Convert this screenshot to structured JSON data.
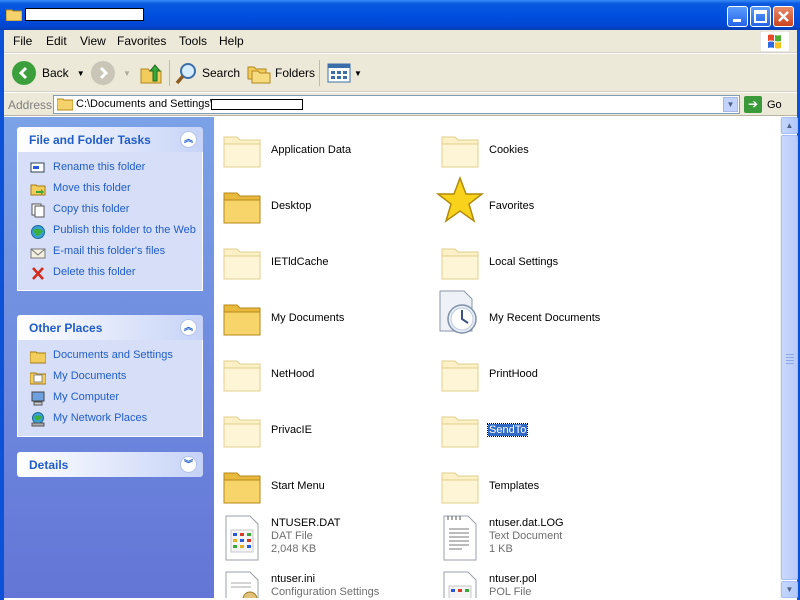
{
  "window": {
    "title": "",
    "controls": [
      "minimize",
      "maximize",
      "close"
    ]
  },
  "menu": [
    "File",
    "Edit",
    "View",
    "Favorites",
    "Tools",
    "Help"
  ],
  "toolbar": {
    "back": "Back",
    "search": "Search",
    "folders": "Folders"
  },
  "address": {
    "label": "Address",
    "path": "C:\\Documents and Settings\\",
    "go": "Go"
  },
  "tasks_panel": {
    "title": "File and Folder Tasks",
    "items": [
      {
        "label": "Rename this folder",
        "icon": "rename-icon"
      },
      {
        "label": "Move this folder",
        "icon": "move-icon"
      },
      {
        "label": "Copy this folder",
        "icon": "copy-icon"
      },
      {
        "label": "Publish this folder to the Web",
        "icon": "publish-icon"
      },
      {
        "label": "E-mail this folder's files",
        "icon": "email-icon"
      },
      {
        "label": "Delete this folder",
        "icon": "delete-icon"
      }
    ]
  },
  "places_panel": {
    "title": "Other Places",
    "items": [
      {
        "label": "Documents and Settings",
        "icon": "folder-icon"
      },
      {
        "label": "My Documents",
        "icon": "my-documents-icon"
      },
      {
        "label": "My Computer",
        "icon": "my-computer-icon"
      },
      {
        "label": "My Network Places",
        "icon": "network-icon"
      }
    ]
  },
  "details_panel": {
    "title": "Details"
  },
  "files": [
    {
      "name": "Application Data",
      "kind": "folder-faded"
    },
    {
      "name": "Cookies",
      "kind": "folder-faded"
    },
    {
      "name": "Desktop",
      "kind": "folder"
    },
    {
      "name": "Favorites",
      "kind": "star"
    },
    {
      "name": "IETldCache",
      "kind": "folder-faded"
    },
    {
      "name": "Local Settings",
      "kind": "folder-faded"
    },
    {
      "name": "My Documents",
      "kind": "folder"
    },
    {
      "name": "My Recent Documents",
      "kind": "recent"
    },
    {
      "name": "NetHood",
      "kind": "folder-faded"
    },
    {
      "name": "PrintHood",
      "kind": "folder-faded"
    },
    {
      "name": "PrivacIE",
      "kind": "folder-faded"
    },
    {
      "name": "SendTo",
      "kind": "folder-faded",
      "selected": true
    },
    {
      "name": "Start Menu",
      "kind": "folder"
    },
    {
      "name": "Templates",
      "kind": "folder-faded"
    },
    {
      "name": "NTUSER.DAT",
      "kind": "dat",
      "type": "DAT File",
      "size": "2,048 KB"
    },
    {
      "name": "ntuser.dat.LOG",
      "kind": "text",
      "type": "Text Document",
      "size": "1 KB"
    },
    {
      "name": "ntuser.ini",
      "kind": "ini",
      "type": "Configuration Settings"
    },
    {
      "name": "ntuser.pol",
      "kind": "pol",
      "type": "POL File"
    }
  ]
}
